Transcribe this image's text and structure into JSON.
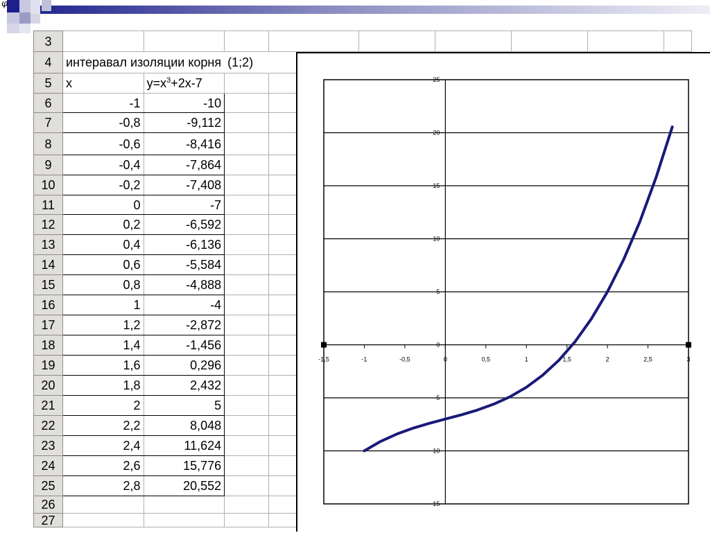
{
  "title_row": {
    "label": "интеравал изоляции корня",
    "interval": "(1;2)"
  },
  "table": {
    "col_x": "x",
    "col_y_prefix": "y=x",
    "col_y_sup": "3",
    "col_y_suffix": "+2x-7",
    "rows": [
      {
        "n": "6",
        "x": "-1",
        "y": "-10"
      },
      {
        "n": "7",
        "x": "-0,8",
        "y": "-9,112"
      },
      {
        "n": "8",
        "x": "-0,6",
        "y": "-8,416"
      },
      {
        "n": "9",
        "x": "-0,4",
        "y": "-7,864"
      },
      {
        "n": "10",
        "x": "-0,2",
        "y": "-7,408"
      },
      {
        "n": "11",
        "x": "0",
        "y": "-7"
      },
      {
        "n": "12",
        "x": "0,2",
        "y": "-6,592"
      },
      {
        "n": "13",
        "x": "0,4",
        "y": "-6,136"
      },
      {
        "n": "14",
        "x": "0,6",
        "y": "-5,584"
      },
      {
        "n": "15",
        "x": "0,8",
        "y": "-4,888"
      },
      {
        "n": "16",
        "x": "1",
        "y": "-4"
      },
      {
        "n": "17",
        "x": "1,2",
        "y": "-2,872"
      },
      {
        "n": "18",
        "x": "1,4",
        "y": "-1,456"
      },
      {
        "n": "19",
        "x": "1,6",
        "y": "0,296"
      },
      {
        "n": "20",
        "x": "1,8",
        "y": "2,432"
      },
      {
        "n": "21",
        "x": "2",
        "y": "5"
      },
      {
        "n": "22",
        "x": "2,2",
        "y": "8,048"
      },
      {
        "n": "23",
        "x": "2,4",
        "y": "11,624"
      },
      {
        "n": "24",
        "x": "2,6",
        "y": "15,776"
      },
      {
        "n": "25",
        "x": "2,8",
        "y": "20,552"
      }
    ],
    "row_numbers": {
      "r3": "3",
      "r4": "4",
      "r5": "5",
      "r26": "26",
      "r27": "27"
    }
  },
  "colors": {
    "line": "#1a1a7a",
    "header_bg": "#e1dfda",
    "deco_blue": "#1c1f8c"
  },
  "chart_data": {
    "type": "line",
    "x": [
      -1,
      -0.8,
      -0.6,
      -0.4,
      -0.2,
      0,
      0.2,
      0.4,
      0.6,
      0.8,
      1,
      1.2,
      1.4,
      1.6,
      1.8,
      2,
      2.2,
      2.4,
      2.6,
      2.8
    ],
    "series": [
      {
        "values": [
          -10,
          -9.112,
          -8.416,
          -7.864,
          -7.408,
          -7,
          -6.592,
          -6.136,
          -5.584,
          -4.888,
          -4,
          -2.872,
          -1.456,
          0.296,
          2.432,
          5,
          8.048,
          11.624,
          15.776,
          20.552
        ]
      }
    ],
    "xlim": [
      -1.5,
      3
    ],
    "ylim": [
      -15,
      25
    ],
    "x_ticks": [
      -1.5,
      -1,
      -0.5,
      0,
      0.5,
      1,
      1.5,
      2,
      2.5,
      3
    ],
    "x_tick_labels": [
      "-1,5",
      "-1",
      "-0,5",
      "0",
      "0,5",
      "1",
      "1,5",
      "2",
      "2,5",
      "3"
    ],
    "y_ticks": [
      -15,
      -10,
      -5,
      0,
      5,
      10,
      15,
      20,
      25
    ],
    "y_tick_labels": [
      "-15",
      "-10",
      "-5",
      "0",
      "5",
      "10",
      "15",
      "20",
      "25"
    ],
    "grid": true
  }
}
